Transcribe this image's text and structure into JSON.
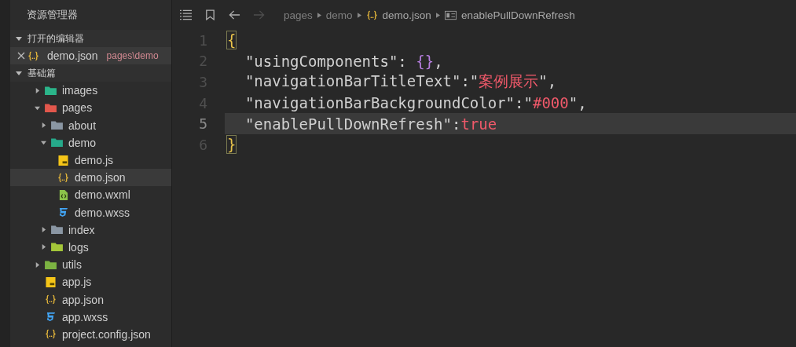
{
  "sidebar": {
    "title": "资源管理器"
  },
  "open_editors": {
    "label": "打开的编辑器",
    "expanded": true,
    "items": [
      {
        "name": "demo.json",
        "path": "pages\\demo",
        "kind": "json",
        "selected": true
      }
    ]
  },
  "project": {
    "label": "基础篇",
    "expanded": true,
    "tree": [
      {
        "name": "images",
        "kind": "folder",
        "color": "#2bb58a",
        "expanded": false,
        "selected": false
      },
      {
        "name": "pages",
        "kind": "folder",
        "color": "#e2574c",
        "expanded": true,
        "selected": false,
        "children": [
          {
            "name": "about",
            "kind": "folder",
            "color": "#8a96a3",
            "expanded": false,
            "selected": false
          },
          {
            "name": "demo",
            "kind": "folder",
            "color": "#26a98a",
            "expanded": true,
            "selected": false,
            "children": [
              {
                "name": "demo.js",
                "kind": "js",
                "selected": false
              },
              {
                "name": "demo.json",
                "kind": "json",
                "selected": true
              },
              {
                "name": "demo.wxml",
                "kind": "wxml",
                "selected": false
              },
              {
                "name": "demo.wxss",
                "kind": "wxss",
                "selected": false
              }
            ]
          },
          {
            "name": "index",
            "kind": "folder",
            "color": "#8a96a3",
            "expanded": false,
            "selected": false
          },
          {
            "name": "logs",
            "kind": "folder",
            "color": "#a4c639",
            "expanded": false,
            "selected": false
          }
        ]
      },
      {
        "name": "utils",
        "kind": "folder",
        "color": "#7cb342",
        "expanded": false,
        "selected": false
      },
      {
        "name": "app.js",
        "kind": "js",
        "selected": false
      },
      {
        "name": "app.json",
        "kind": "json",
        "selected": false
      },
      {
        "name": "app.wxss",
        "kind": "wxss",
        "selected": false
      },
      {
        "name": "project.config.json",
        "kind": "json",
        "selected": false
      }
    ]
  },
  "toolbar": [
    {
      "kind": "outline",
      "disabled": false
    },
    {
      "kind": "bookmark",
      "disabled": false
    },
    {
      "kind": "back",
      "disabled": false
    },
    {
      "kind": "forward",
      "disabled": true
    }
  ],
  "breadcrumb": [
    {
      "text": "pages",
      "kind": "folder"
    },
    {
      "text": "demo",
      "kind": "folder"
    },
    {
      "text": "demo.json",
      "kind": "json"
    },
    {
      "text": "enablePullDownRefresh",
      "kind": "property"
    }
  ],
  "code": [
    {
      "number": "1",
      "current": false,
      "tokens": [
        {
          "text": "{",
          "kind": "brace-matched"
        }
      ]
    },
    {
      "number": "2",
      "current": false,
      "tokens": [
        {
          "text": "  \"usingComponents\"",
          "kind": "key"
        },
        {
          "text": ": ",
          "kind": "punct"
        },
        {
          "text": "{}",
          "kind": "object"
        },
        {
          "text": ",",
          "kind": "punct"
        }
      ]
    },
    {
      "number": "3",
      "current": false,
      "tokens": [
        {
          "text": "  \"navigationBarTitleText\"",
          "kind": "key"
        },
        {
          "text": ":\"",
          "kind": "punct"
        },
        {
          "text": "案例展示",
          "kind": "string"
        },
        {
          "text": "\",",
          "kind": "punct"
        }
      ]
    },
    {
      "number": "4",
      "current": false,
      "tokens": [
        {
          "text": "  \"navigationBarBackgroundColor\"",
          "kind": "key"
        },
        {
          "text": ":\"",
          "kind": "punct"
        },
        {
          "text": "#000",
          "kind": "string"
        },
        {
          "text": "\",",
          "kind": "punct"
        }
      ]
    },
    {
      "number": "5",
      "current": true,
      "tokens": [
        {
          "text": "  \"enablePullDownRefresh\"",
          "kind": "key"
        },
        {
          "text": ":",
          "kind": "punct"
        },
        {
          "text": "true",
          "kind": "bool"
        }
      ]
    },
    {
      "number": "6",
      "current": false,
      "tokens": [
        {
          "text": "}",
          "kind": "brace-matched"
        }
      ]
    }
  ]
}
